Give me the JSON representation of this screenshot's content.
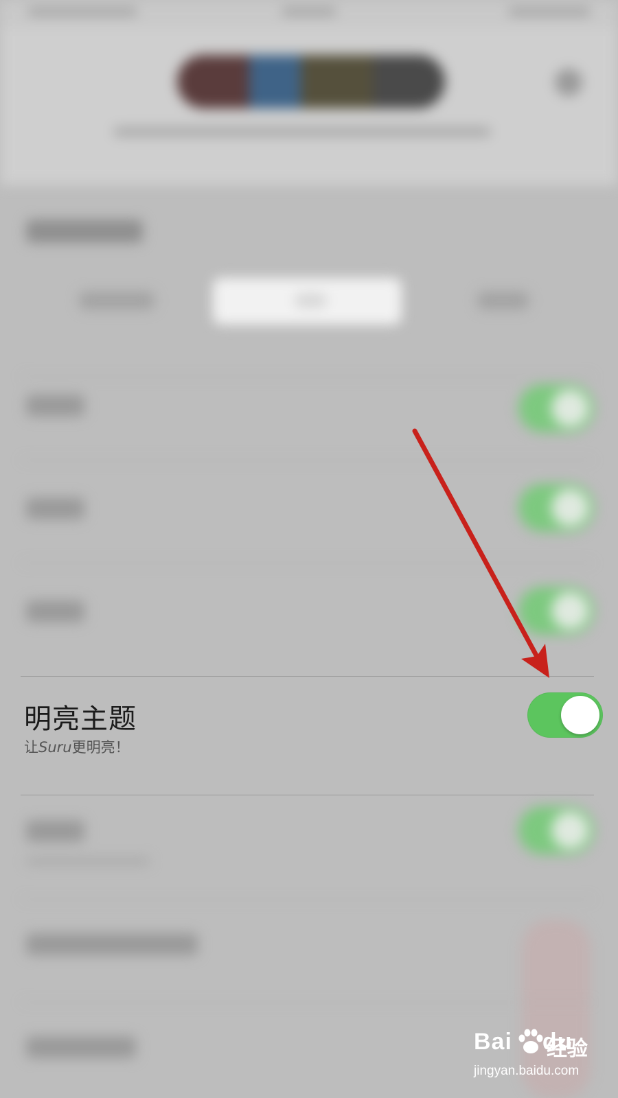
{
  "setting": {
    "title": "明亮主题",
    "subtitle_prefix": "让",
    "subtitle_brand": "Suru",
    "subtitle_suffix": "更明亮！",
    "toggle_on": true
  },
  "colors": {
    "toggle_on": "#5cc55e",
    "arrow": "#c8211b",
    "background": "#bdbdbd"
  },
  "watermark": {
    "brand_left": "Bai",
    "brand_right": "du",
    "jingyan": "经验",
    "url": "jingyan.baidu.com"
  }
}
